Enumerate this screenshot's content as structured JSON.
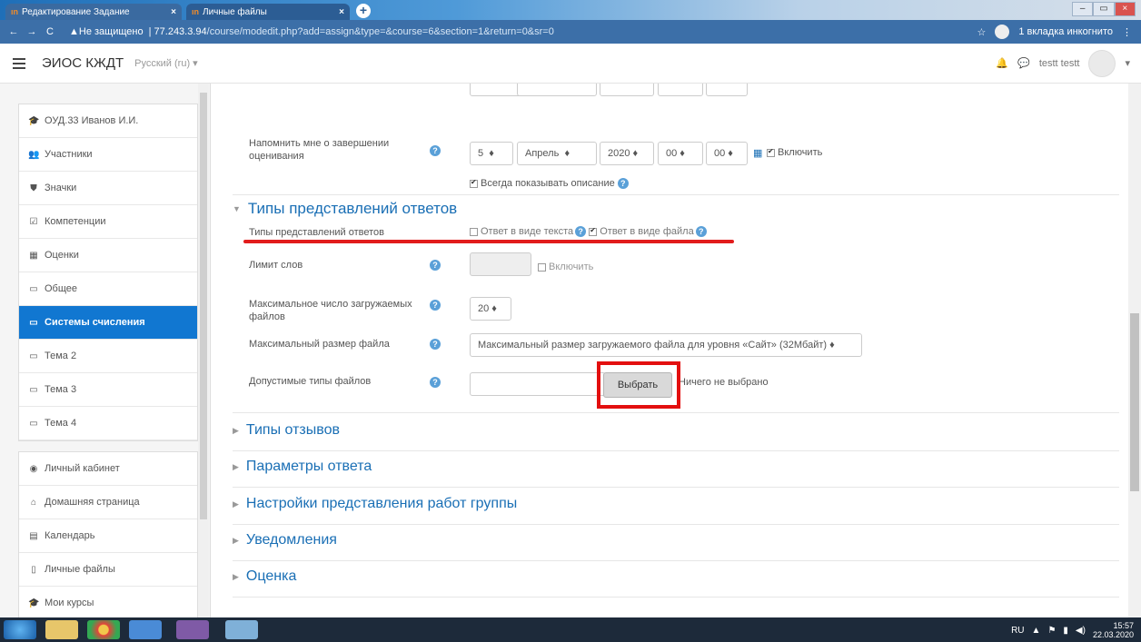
{
  "browser": {
    "tabs": [
      {
        "label": "Редактирование Задание"
      },
      {
        "label": "Личные файлы"
      }
    ],
    "address": {
      "insecure_label": "Не защищено",
      "host": "77.243.3.94",
      "path": "/course/modedit.php?add=assign&type=&course=6&section=1&return=0&sr=0"
    },
    "incognito_label": "1 вкладка инкогнито"
  },
  "topnav": {
    "site_name": "ЭИОС КЖДТ",
    "language": "Русский (ru) ▾",
    "user_name": "testt testt"
  },
  "sidebar": {
    "group1": [
      {
        "icon": "graduation-cap-icon",
        "glyph": "🎓",
        "label": "ОУД.33 Иванов И.И.",
        "active": false
      },
      {
        "icon": "users-icon",
        "glyph": "👥",
        "label": "Участники",
        "active": false
      },
      {
        "icon": "shield-icon",
        "glyph": "⛊",
        "label": "Значки",
        "active": false
      },
      {
        "icon": "checkbox-icon",
        "glyph": "☑",
        "label": "Компетенции",
        "active": false
      },
      {
        "icon": "table-icon",
        "glyph": "▦",
        "label": "Оценки",
        "active": false
      },
      {
        "icon": "folder-icon",
        "glyph": "▭",
        "label": "Общее",
        "active": false
      },
      {
        "icon": "folder-icon",
        "glyph": "▭",
        "label": "Системы счисления",
        "active": true
      },
      {
        "icon": "folder-icon",
        "glyph": "▭",
        "label": "Тема 2",
        "active": false
      },
      {
        "icon": "folder-icon",
        "glyph": "▭",
        "label": "Тема 3",
        "active": false
      },
      {
        "icon": "folder-icon",
        "glyph": "▭",
        "label": "Тема 4",
        "active": false
      }
    ],
    "group2": [
      {
        "icon": "dashboard-icon",
        "glyph": "◉",
        "label": "Личный кабинет"
      },
      {
        "icon": "home-icon",
        "glyph": "⌂",
        "label": "Домашняя страница"
      },
      {
        "icon": "calendar-icon",
        "glyph": "▤",
        "label": "Календарь"
      },
      {
        "icon": "file-icon",
        "glyph": "▯",
        "label": "Личные файлы"
      },
      {
        "icon": "graduation-cap-icon",
        "glyph": "🎓",
        "label": "Мои курсы"
      }
    ]
  },
  "form": {
    "remind": {
      "label": "Напомнить мне о завершении оценивания",
      "day": "5",
      "month": "Апрель",
      "year": "2020",
      "hour": "00",
      "minute": "00",
      "enable_label": "Включить"
    },
    "always_show_label": "Всегда показывать описание",
    "submission_section": "Типы представлений ответов",
    "submission_types": {
      "label": "Типы представлений ответов",
      "text_option": "Ответ в виде текста",
      "file_option": "Ответ в виде файла"
    },
    "word_limit": {
      "label": "Лимит слов",
      "enable_label": "Включить"
    },
    "max_files": {
      "label": "Максимальное число загружаемых файлов",
      "value": "20"
    },
    "max_size": {
      "label": "Максимальный размер файла",
      "value": "Максимальный размер загружаемого файла для уровня «Сайт» (32Мбайт)"
    },
    "file_types": {
      "label": "Допустимые типы файлов",
      "button": "Выбрать",
      "status": "Ничего не выбрано"
    },
    "sections": [
      "Типы отзывов",
      "Параметры ответа",
      "Настройки представления работ группы",
      "Уведомления",
      "Оценка"
    ]
  },
  "taskbar": {
    "lang": "RU",
    "time": "15:57",
    "date": "22.03.2020"
  }
}
